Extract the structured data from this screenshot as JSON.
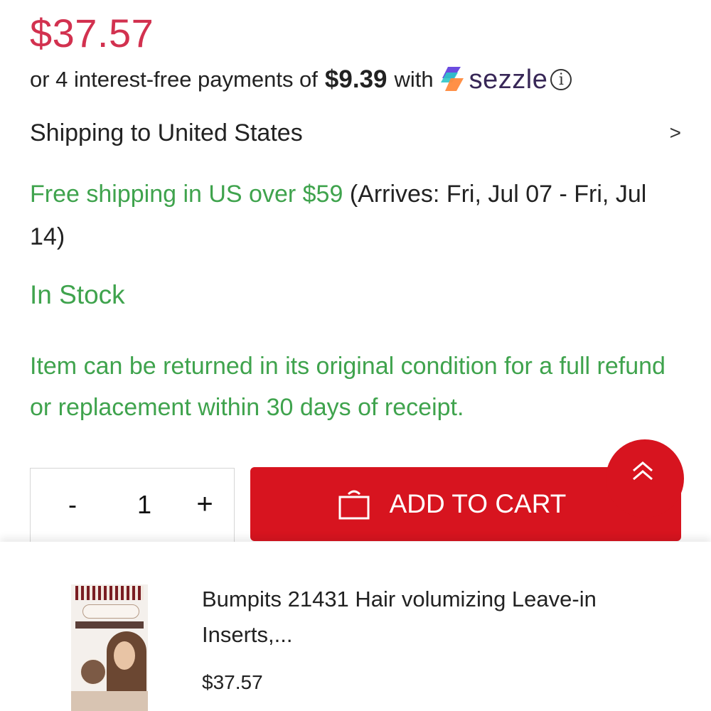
{
  "product": {
    "price": "$37.57",
    "title": "Bumpits 21431 Hair volumizing Leave-in Inserts,...",
    "sticky_price": "$37.57"
  },
  "sezzle": {
    "prefix": "or 4 interest-free payments of",
    "installment": "$9.39",
    "with": "with",
    "brand": "sezzle",
    "info_glyph": "ⓘ",
    "logo_icon": "sezzle-logo-icon",
    "info_icon": "info-circle-icon"
  },
  "shipping": {
    "destination_label": "Shipping to United States",
    "chevron": ">",
    "free_label": "Free shipping in US over $59",
    "arrives": "(Arrives: Fri, Jul 07 - Fri, Jul 14)"
  },
  "stock_status": "In Stock",
  "returns_policy": "Item can be returned in its original condition for a full refund or replacement within 30 days of receipt.",
  "quantity": {
    "minus": "-",
    "value": "1",
    "plus": "+"
  },
  "cart": {
    "label": "ADD TO CART",
    "icon": "shopping-bag-icon"
  },
  "scroll_top_icon": "double-chevron-up-icon",
  "colors": {
    "price": "#d2314f",
    "green": "#3fa34d",
    "cart_red": "#d7141f",
    "sezzle_purple": "#382757"
  }
}
